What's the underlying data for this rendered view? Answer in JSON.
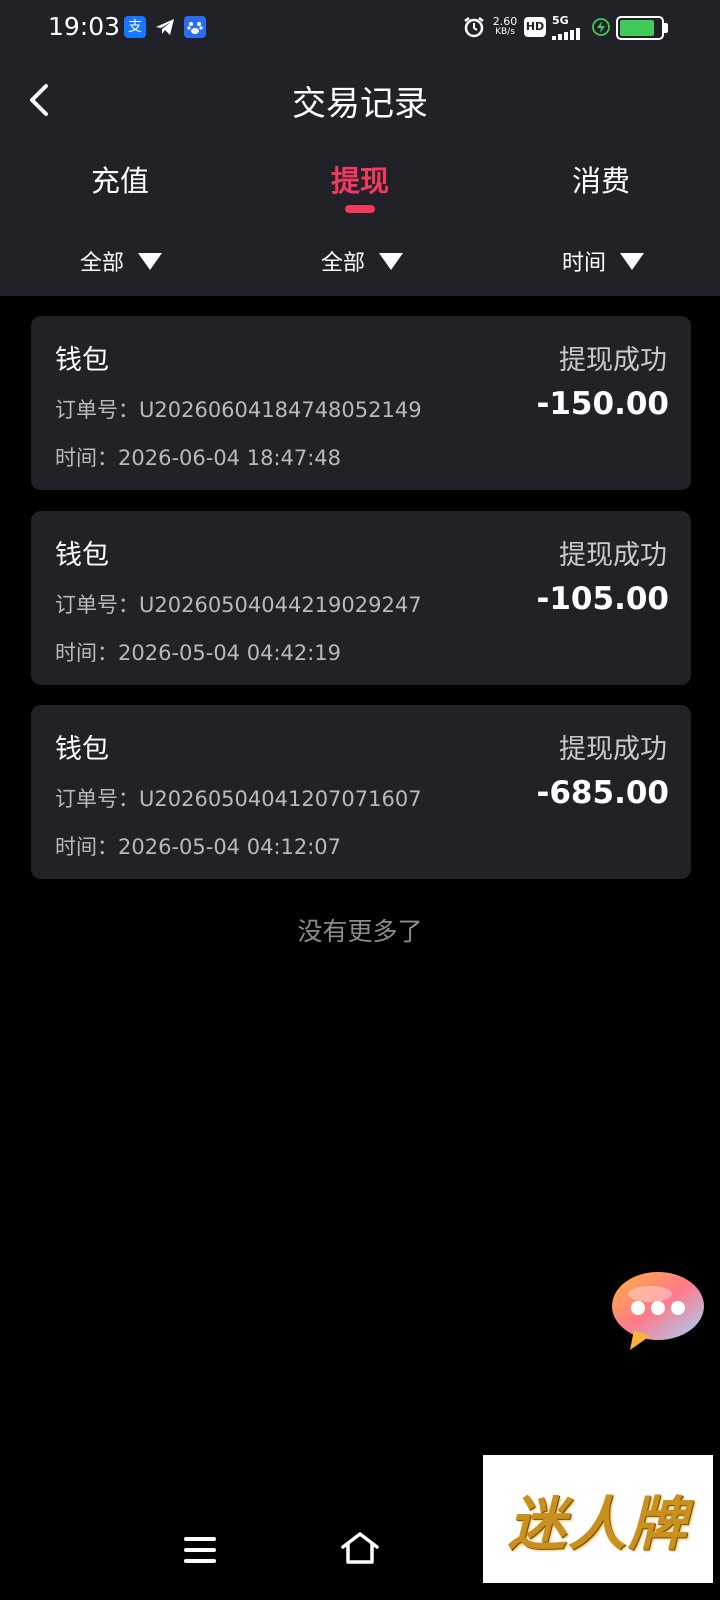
{
  "status_bar": {
    "time": "19:03",
    "net_speed_value": "2.60",
    "net_speed_unit": "KB/s",
    "hd_label": "HD",
    "network_label": "5G",
    "battery_level": 0.85,
    "apps": [
      "alipay-icon",
      "telegram-icon",
      "baidu-icon"
    ]
  },
  "header": {
    "title": "交易记录",
    "back_icon": "chevron-left-icon"
  },
  "tabs": [
    {
      "label": "充值",
      "active": false
    },
    {
      "label": "提现",
      "active": true
    },
    {
      "label": "消费",
      "active": false
    }
  ],
  "filters": [
    {
      "label": "全部"
    },
    {
      "label": "全部"
    },
    {
      "label": "时间"
    }
  ],
  "records": [
    {
      "source": "钱包",
      "status": "提现成功",
      "order": "订单号：U20260604184748052149",
      "amount": "-150.00",
      "time": "时间：2026-06-04 18:47:48"
    },
    {
      "source": "钱包",
      "status": "提现成功",
      "order": "订单号：U20260504044219029247",
      "amount": "-105.00",
      "time": "时间：2026-05-04 04:42:19"
    },
    {
      "source": "钱包",
      "status": "提现成功",
      "order": "订单号：U20260504041207071607",
      "amount": "-685.00",
      "time": "时间：2026-05-04 04:12:07"
    }
  ],
  "footer": {
    "no_more": "没有更多了"
  },
  "watermark": {
    "text": "迷人牌"
  },
  "colors": {
    "accent": "#f23a5e",
    "panel": "#212228",
    "background": "#000000"
  }
}
